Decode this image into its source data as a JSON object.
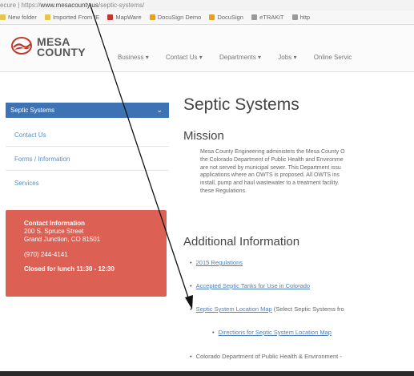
{
  "browser": {
    "address": {
      "prefix": "ecure | https://",
      "domain": "www.mesacounty.us",
      "path": "/septic-systems/"
    },
    "bookmarks": [
      {
        "label": "New folder",
        "color": "#e6c64a"
      },
      {
        "label": "Imported From IE",
        "color": "#e6c64a"
      },
      {
        "label": "MapWare",
        "color": "#c0392b"
      },
      {
        "label": "DocuSign Demo",
        "color": "#e8a020"
      },
      {
        "label": "DocuSign",
        "color": "#e8a020"
      },
      {
        "label": "eTRAKiT",
        "color": "#999999"
      },
      {
        "label": "http",
        "color": "#999999"
      }
    ]
  },
  "header": {
    "logo_line1": "MESA",
    "logo_line2": "COUNTY",
    "nav": [
      "Business",
      "Contact Us",
      "Departments",
      "Jobs",
      "Online Servic"
    ]
  },
  "sidebar": {
    "active": "Septic Systems",
    "links": [
      "Contact Us",
      "Forms / Information",
      "Services"
    ],
    "contact": {
      "title": "Contact Information",
      "street": "200 S. Spruce Street",
      "city": "Grand Junction, CO 81501",
      "phone": "(970) 244-4141",
      "note": "Closed for lunch 11:30 - 12:30"
    }
  },
  "main": {
    "title": "Septic Systems",
    "mission_heading": "Mission",
    "mission_lines": [
      "Mesa County Engineering administers the Mesa County O",
      "the Colorado Department of Public Health and Environme",
      "are not served by municipal sewer.  This Department issu",
      "applications where an OWTS is proposed.  All OWTS ins",
      "install, pump and haul wastewater to a treatment facility.",
      "these Regulations."
    ],
    "additional_heading": "Additional Information",
    "items": {
      "regs": "2015 Regulations",
      "tanks": "Accepted Septic Tanks for Use in Colorado",
      "map": "Septic System Location Map",
      "map_suffix": "(Select Septic Systems fro",
      "directions": "Directions for Septic System Location Map",
      "cdphe": "Colorado Department of Public Health & Environment -"
    }
  },
  "colors": {
    "sidebar_active": "#3d72b4",
    "contact_box": "#dd6055",
    "link": "#4f7fb8"
  }
}
